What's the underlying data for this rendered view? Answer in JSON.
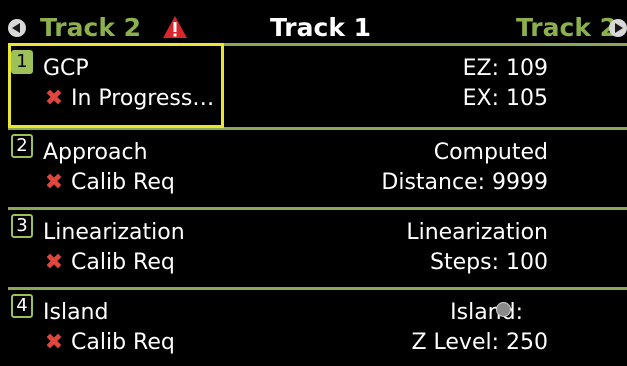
{
  "header": {
    "prev_track": "Track 2",
    "title": "Track 1",
    "next_track": "Track 2",
    "prev_icon": "chevron-left-icon",
    "next_icon": "chevron-right-icon",
    "warning_icon": "warning-icon"
  },
  "colors": {
    "accent_green": "#8cb04c",
    "selection_yellow": "#e8e633",
    "error_red": "#e0463c",
    "warning_red": "#d9262b"
  },
  "steps": [
    {
      "number": "1",
      "name": "GCP",
      "status": "In Progress…",
      "status_icon": "x-icon",
      "right_line1": "EZ: 109",
      "right_line2": "EX: 105",
      "selected": true
    },
    {
      "number": "2",
      "name": "Approach",
      "status": "Calib Req",
      "status_icon": "x-icon",
      "right_line1": "Computed",
      "right_line2": "Distance: 9999"
    },
    {
      "number": "3",
      "name": "Linearization",
      "status": "Calib Req",
      "status_icon": "x-icon",
      "right_line1": "Linearization",
      "right_line2": "Steps: 100"
    },
    {
      "number": "4",
      "name": "Island",
      "status": "Calib Req",
      "status_icon": "x-icon",
      "right_line1": "Island:",
      "right_line2": "Z Level: 250",
      "indicator_icon": "status-dot-icon"
    }
  ]
}
